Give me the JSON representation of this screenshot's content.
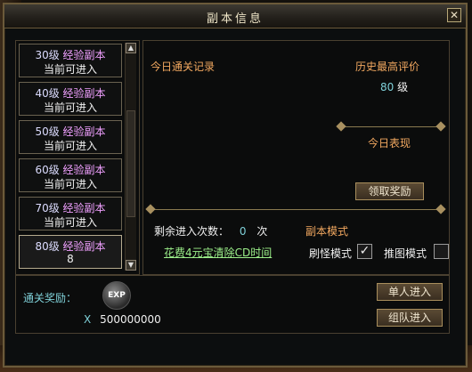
{
  "window": {
    "title": "副本信息",
    "close_glyph": "✕"
  },
  "dungeon_list": {
    "items": [
      {
        "level": "30级",
        "type": "经验副本",
        "status": "当前可进入"
      },
      {
        "level": "40级",
        "type": "经验副本",
        "status": "当前可进入"
      },
      {
        "level": "50级",
        "type": "经验副本",
        "status": "当前可进入"
      },
      {
        "level": "60级",
        "type": "经验副本",
        "status": "当前可进入"
      },
      {
        "level": "70级",
        "type": "经验副本",
        "status": "当前可进入"
      },
      {
        "level": "80级",
        "type": "经验副本",
        "status": "8"
      }
    ],
    "selected_index": 5
  },
  "details": {
    "today_record_label": "今日通关记录",
    "best_rating_label": "历史最高评价",
    "best_rating_value": "80",
    "best_rating_unit": "级",
    "today_performance_label": "今日表现",
    "claim_reward_button": "领取奖励",
    "remaining_entries_label": "剩余进入次数：",
    "remaining_entries_value": "0",
    "remaining_entries_unit": "次",
    "dungeon_mode_label": "副本模式",
    "clear_cd_link": "花费4元宝清除CD时间",
    "mode_monster_label": "刷怪模式",
    "mode_monster_checked": true,
    "mode_push_label": "推图模式",
    "mode_push_checked": false
  },
  "reward": {
    "label": "通关奖励：",
    "icon_text": "EXP",
    "multiplier": "X",
    "amount": "500000000"
  },
  "actions": {
    "solo_enter": "单人进入",
    "team_enter": "组队进入"
  },
  "colors": {
    "accent_orange": "#f2a860",
    "accent_cyan": "#7fd0d8",
    "link_green": "#9cf08a",
    "dungeon_type": "#f0a0ff",
    "frame_gold": "#a88e5c"
  }
}
